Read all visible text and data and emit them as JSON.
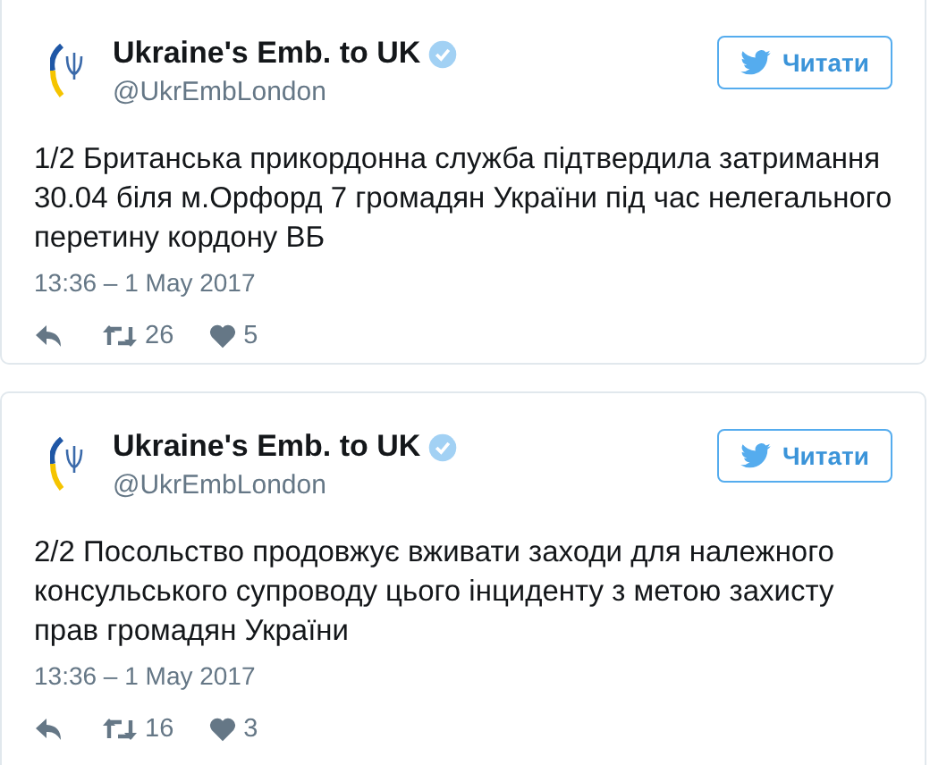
{
  "tweets": [
    {
      "name": "Ukraine's Emb. to UK",
      "verified": true,
      "handle": "@UkrEmbLondon",
      "follow_button": "Читати",
      "text": "1/2 Британська прикордонна служба підтвердила затримання 30.04 біля м.Орфорд 7 громадян України під час нелегального перетину кордону ВБ",
      "time": "13:36 – 1 May 2017",
      "retweets": "26",
      "likes": "5"
    },
    {
      "name": "Ukraine's Emb. to UK",
      "verified": true,
      "handle": "@UkrEmbLondon",
      "follow_button": "Читати",
      "text": "2/2 Посольство продовжує вживати заходи для належного консульського супроводу цього інциденту з метою захисту прав громадян України",
      "time": "13:36 – 1 May 2017",
      "retweets": "16",
      "likes": "3"
    }
  ]
}
